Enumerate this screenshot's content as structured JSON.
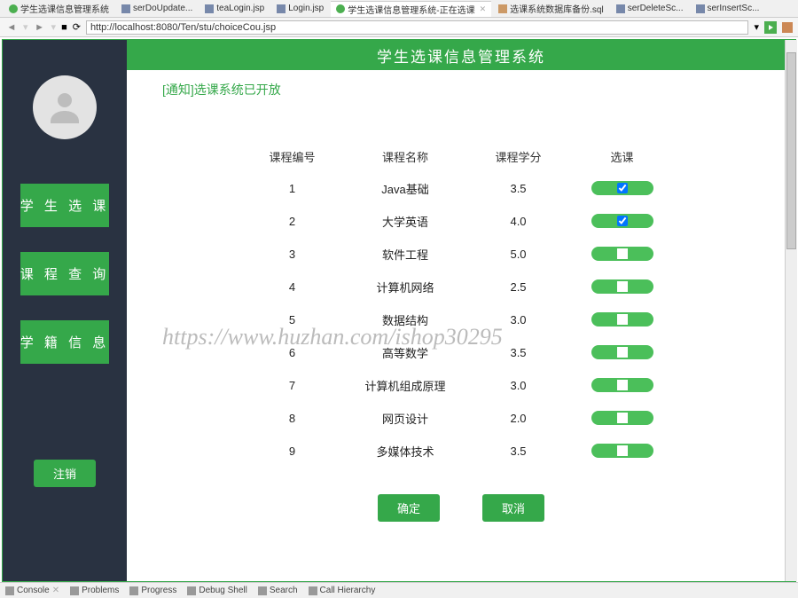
{
  "ide_tabs": [
    {
      "label": "学生选课信息管理系统",
      "icon": "g"
    },
    {
      "label": "serDoUpdate...",
      "icon": "f"
    },
    {
      "label": "teaLogin.jsp",
      "icon": "f"
    },
    {
      "label": "Login.jsp",
      "icon": "f"
    },
    {
      "label": "学生选课信息管理系统-正在选课",
      "icon": "g",
      "active": true
    },
    {
      "label": "选课系统数据库备份.sql",
      "icon": "s"
    },
    {
      "label": "serDeleteSc...",
      "icon": "f"
    },
    {
      "label": "serInsertSc...",
      "icon": "f"
    }
  ],
  "url": "http://localhost:8080/Ten/stu/choiceCou.jsp",
  "header_title": "学生选课信息管理系统",
  "notice": "[通知]选课系统已开放",
  "sidebar": {
    "items": [
      "学 生 选 课",
      "课 程 查 询",
      "学 籍 信 息"
    ],
    "logout": "注销"
  },
  "table": {
    "headers": [
      "课程编号",
      "课程名称",
      "课程学分",
      "选课"
    ],
    "rows": [
      {
        "id": "1",
        "name": "Java基础",
        "credit": "3.5",
        "checked": true
      },
      {
        "id": "2",
        "name": "大学英语",
        "credit": "4.0",
        "checked": true
      },
      {
        "id": "3",
        "name": "软件工程",
        "credit": "5.0",
        "checked": false
      },
      {
        "id": "4",
        "name": "计算机网络",
        "credit": "2.5",
        "checked": false
      },
      {
        "id": "5",
        "name": "数据结构",
        "credit": "3.0",
        "checked": false
      },
      {
        "id": "6",
        "name": "高等数学",
        "credit": "3.5",
        "checked": false
      },
      {
        "id": "7",
        "name": "计算机组成原理",
        "credit": "3.0",
        "checked": false
      },
      {
        "id": "8",
        "name": "网页设计",
        "credit": "2.0",
        "checked": false
      },
      {
        "id": "9",
        "name": "多媒体技术",
        "credit": "3.5",
        "checked": false
      }
    ]
  },
  "buttons": {
    "ok": "确定",
    "cancel": "取消"
  },
  "watermark": "https://www.huzhan.com/ishop30295",
  "status_bar": [
    "Console",
    "Problems",
    "Progress",
    "Debug Shell",
    "Search",
    "Call Hierarchy"
  ]
}
